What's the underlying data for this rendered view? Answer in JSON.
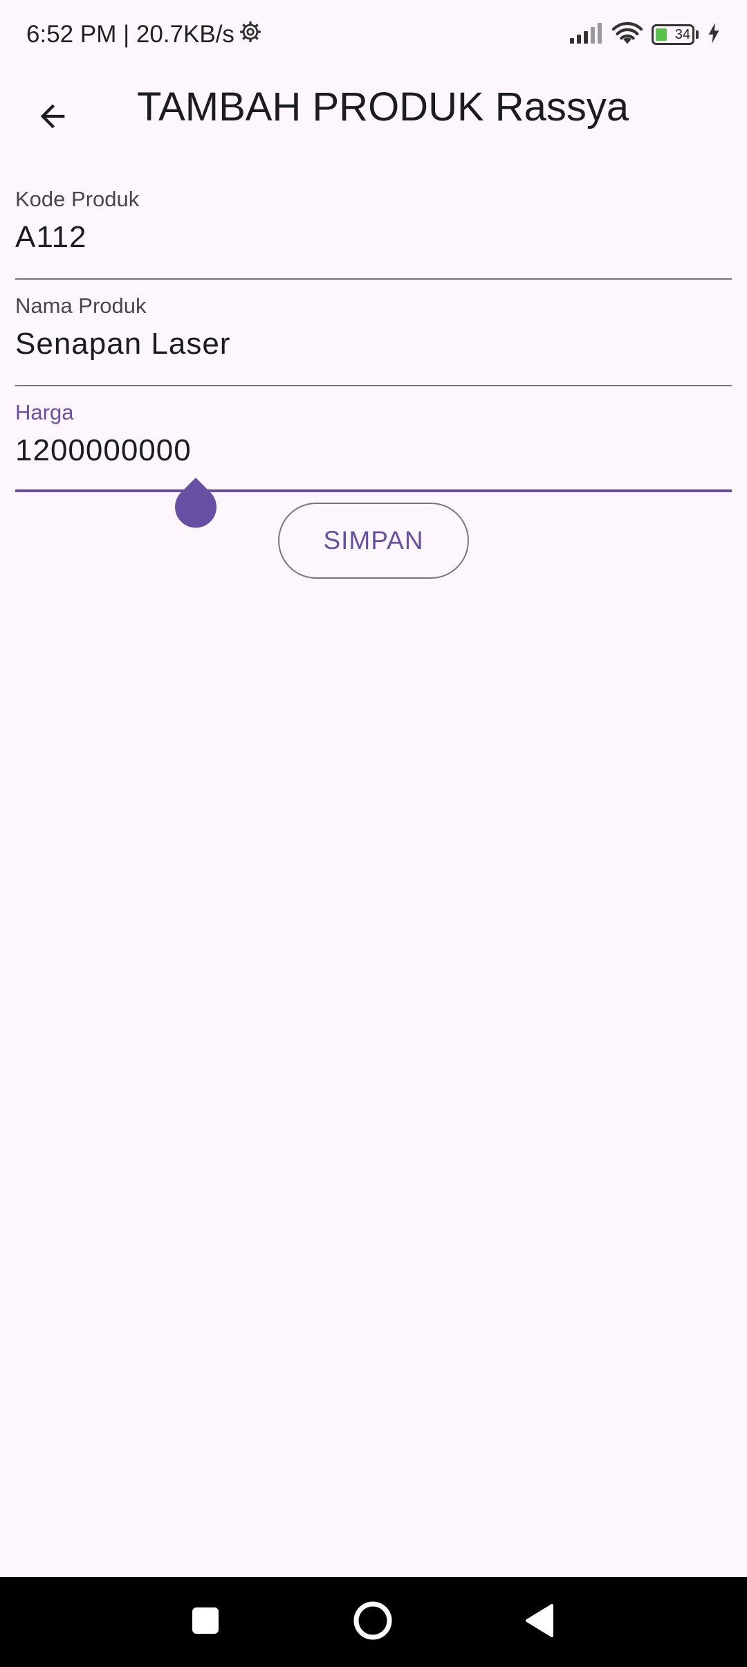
{
  "status_bar": {
    "time_speed": "6:52 PM | 20.7KB/s",
    "battery_level": "34"
  },
  "app_bar": {
    "title": "TAMBAH PRODUK Rassya"
  },
  "form": {
    "kode_produk": {
      "label": "Kode Produk",
      "value": "A112"
    },
    "nama_produk": {
      "label": "Nama Produk",
      "value": "Senapan Laser"
    },
    "harga": {
      "label": "Harga",
      "value": "1200000000"
    }
  },
  "actions": {
    "save_label": "SIMPAN"
  },
  "colors": {
    "primary": "#6750a4",
    "background": "#fdf7fd",
    "outline": "#79747e"
  }
}
